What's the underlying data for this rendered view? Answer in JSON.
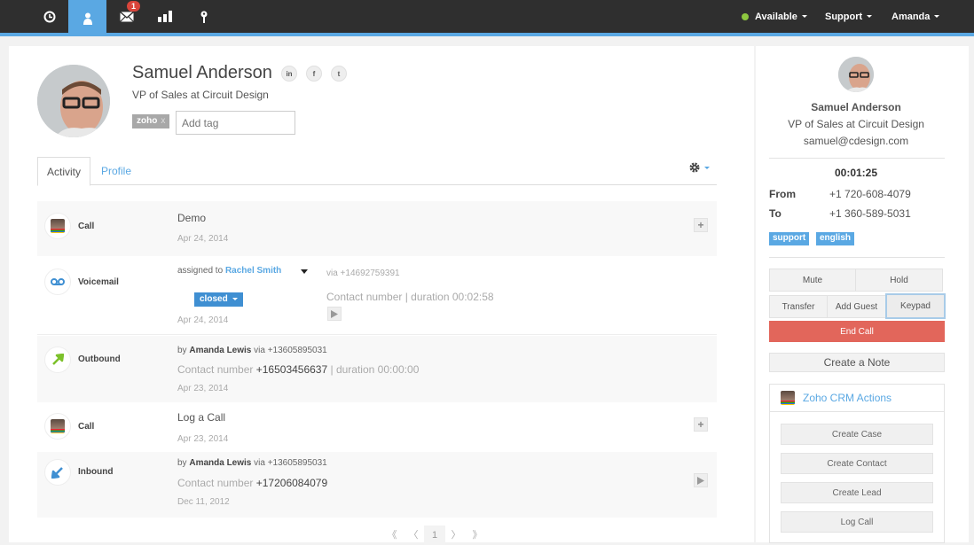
{
  "nav": {
    "icons": [
      {
        "name": "history",
        "active": false
      },
      {
        "name": "contact",
        "active": true
      },
      {
        "name": "inbox",
        "active": false,
        "badge": "1"
      },
      {
        "name": "reports",
        "active": false
      },
      {
        "name": "location",
        "active": false
      }
    ],
    "status": "Available",
    "status_color": "#8dc63f",
    "support": "Support",
    "user": "Amanda"
  },
  "contact": {
    "name": "Samuel Anderson",
    "title": "VP of Sales at Circuit Design",
    "email": "samuel@cdesign.com",
    "social": [
      "in",
      "f",
      "t"
    ],
    "tags": [
      {
        "label": "zoho",
        "remove": "x"
      }
    ],
    "tag_placeholder": "Add tag"
  },
  "tabs": [
    {
      "label": "Activity",
      "active": true
    },
    {
      "label": "Profile",
      "active": false
    }
  ],
  "activities": [
    {
      "type": "Call",
      "title": "Demo",
      "date": "Apr 24, 2014",
      "action": "+"
    },
    {
      "type": "Voicemail",
      "assigned_prefix": "assigned to",
      "assignee": "Rachel Smith",
      "via": "via +14692759391",
      "status": "closed",
      "contact_text": "Contact number | duration 00:02:58",
      "date": "Apr 24, 2014"
    },
    {
      "type": "Outbound",
      "by_prefix": "by",
      "agent": "Amanda Lewis",
      "via": "via +13605895031",
      "contact_label": "Contact number",
      "contact_number": "+16503456637",
      "duration": "| duration 00:00:00",
      "date": "Apr 23, 2014"
    },
    {
      "type": "Call",
      "title": "Log a Call",
      "date": "Apr 23, 2014",
      "action": "+"
    },
    {
      "type": "Inbound",
      "by_prefix": "by",
      "agent": "Amanda Lewis",
      "via": "via +13605895031",
      "contact_label": "Contact number",
      "contact_number": "+17206084079",
      "date": "Dec 11, 2012"
    }
  ],
  "pagination": {
    "first": "《",
    "prev": "〈",
    "current": "1",
    "next": "〉",
    "last": "》"
  },
  "call": {
    "timer": "00:01:25",
    "from_label": "From",
    "from": "+1 720-608-4079",
    "to_label": "To",
    "to": "+1 360-589-5031",
    "tags": [
      "support",
      "english"
    ],
    "buttons": {
      "mute": "Mute",
      "hold": "Hold",
      "transfer": "Transfer",
      "add_guest": "Add Guest",
      "keypad": "Keypad",
      "end_call": "End Call",
      "create_note": "Create a Note"
    }
  },
  "crm": {
    "title": "Zoho CRM Actions",
    "actions": [
      "Create Case",
      "Create Contact",
      "Create Lead",
      "Log Call"
    ]
  }
}
